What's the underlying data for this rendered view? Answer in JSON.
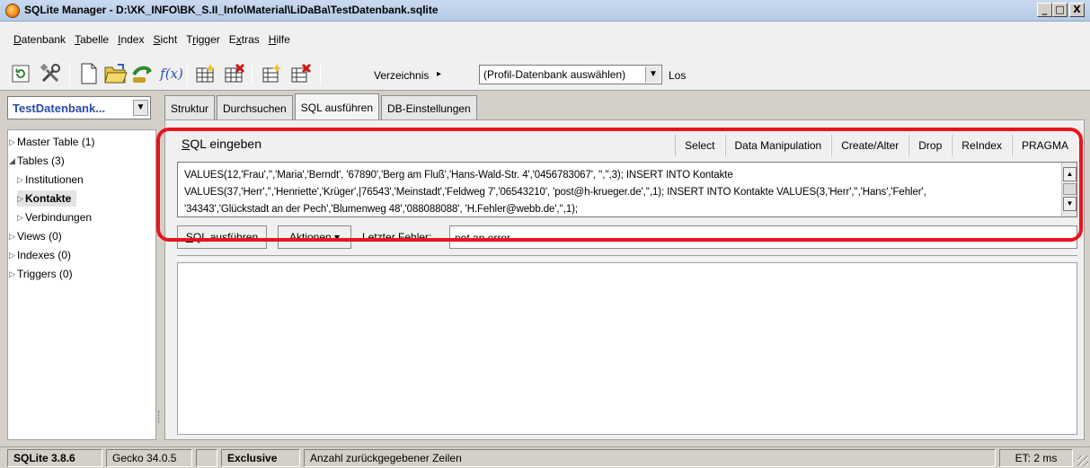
{
  "window": {
    "title": "SQLite Manager - D:\\XK_INFO\\BK_S.II_Info\\Material\\LiDaBa\\TestDatenbank.sqlite",
    "buttons": [
      "_",
      "□",
      "X"
    ]
  },
  "menu": [
    {
      "pre": "",
      "ul": "D",
      "post": "atenbank"
    },
    {
      "pre": "",
      "ul": "T",
      "post": "abelle"
    },
    {
      "pre": "",
      "ul": "I",
      "post": "ndex"
    },
    {
      "pre": "",
      "ul": "S",
      "post": "icht"
    },
    {
      "pre": "T",
      "ul": "r",
      "post": "igger"
    },
    {
      "pre": "E",
      "ul": "x",
      "post": "tras"
    },
    {
      "pre": "",
      "ul": "H",
      "post": "ilfe"
    }
  ],
  "toolbar": {
    "icons": [
      "refresh-icon",
      "settings-tools-icon",
      "new-database-icon",
      "open-database-icon",
      "attach-database-icon",
      "function-icon",
      "create-table-icon",
      "drop-table-icon",
      "create-index-icon",
      "drop-index-icon"
    ],
    "function_label": "f(x)",
    "directory_label": "Verzeichnis",
    "arrow": "▸",
    "profile_value": "(Profil-Datenbank auswählen)",
    "go_label": "Los"
  },
  "sidebar": {
    "database": "TestDatenbank...",
    "tree": [
      {
        "label": "Master Table (1)",
        "tri": "▷",
        "indent": 0,
        "selected": false
      },
      {
        "label": "Tables (3)",
        "tri": "◢",
        "indent": 0,
        "selected": false
      },
      {
        "label": "Institutionen",
        "tri": "▷",
        "indent": 1,
        "selected": false
      },
      {
        "label": "Kontakte",
        "tri": "▷",
        "indent": 1,
        "selected": true
      },
      {
        "label": "Verbindungen",
        "tri": "▷",
        "indent": 1,
        "selected": false
      },
      {
        "label": "Views (0)",
        "tri": "▷",
        "indent": 0,
        "selected": false
      },
      {
        "label": "Indexes (0)",
        "tri": "▷",
        "indent": 0,
        "selected": false
      },
      {
        "label": "Triggers (0)",
        "tri": "▷",
        "indent": 0,
        "selected": false
      }
    ]
  },
  "tabs": [
    {
      "label": "Struktur",
      "active": false
    },
    {
      "label": "Durchsuchen",
      "active": false
    },
    {
      "label": "SQL ausführen",
      "active": true
    },
    {
      "label": "DB-Einstellungen",
      "active": false
    }
  ],
  "sql": {
    "header_ul": "S",
    "header_rest": "QL eingeben",
    "categories": [
      "Select",
      "Data Manipulation",
      "Create/Alter",
      "Drop",
      "ReIndex",
      "PRAGMA"
    ],
    "text": "VALUES(12,'Frau','','Maria','Berndt', '67890','Berg am Fluß','Hans-Wald-Str. 4','0456783067', '','',3); INSERT INTO Kontakte\nVALUES(37,'Herr','','Henriette','Krüger',|76543','Meinstadt','Feldweg 7','06543210', 'post@h-krueger.de','',1); INSERT INTO Kontakte VALUES(3,'Herr','','Hans','Fehler',\n'34343','Glückstadt an der Pech','Blumenweg 48','088088088', 'H.Fehler@webb.de','',1);",
    "execute_ul": "S",
    "execute_rest": "QL ausführen",
    "actions_label": "Aktionen ▾",
    "last_error_label": "Letzter Fehler:",
    "last_error_value": "not an error"
  },
  "status": {
    "sqlite": "SQLite 3.8.6",
    "gecko": "Gecko 34.0.5",
    "mode": "Exclusive",
    "message": "Anzahl zurückgegebener Zeilen",
    "elapsed": "ET: 2 ms"
  },
  "colors": {
    "highlight": "#e8141c",
    "db_name": "#2b4ba8"
  }
}
